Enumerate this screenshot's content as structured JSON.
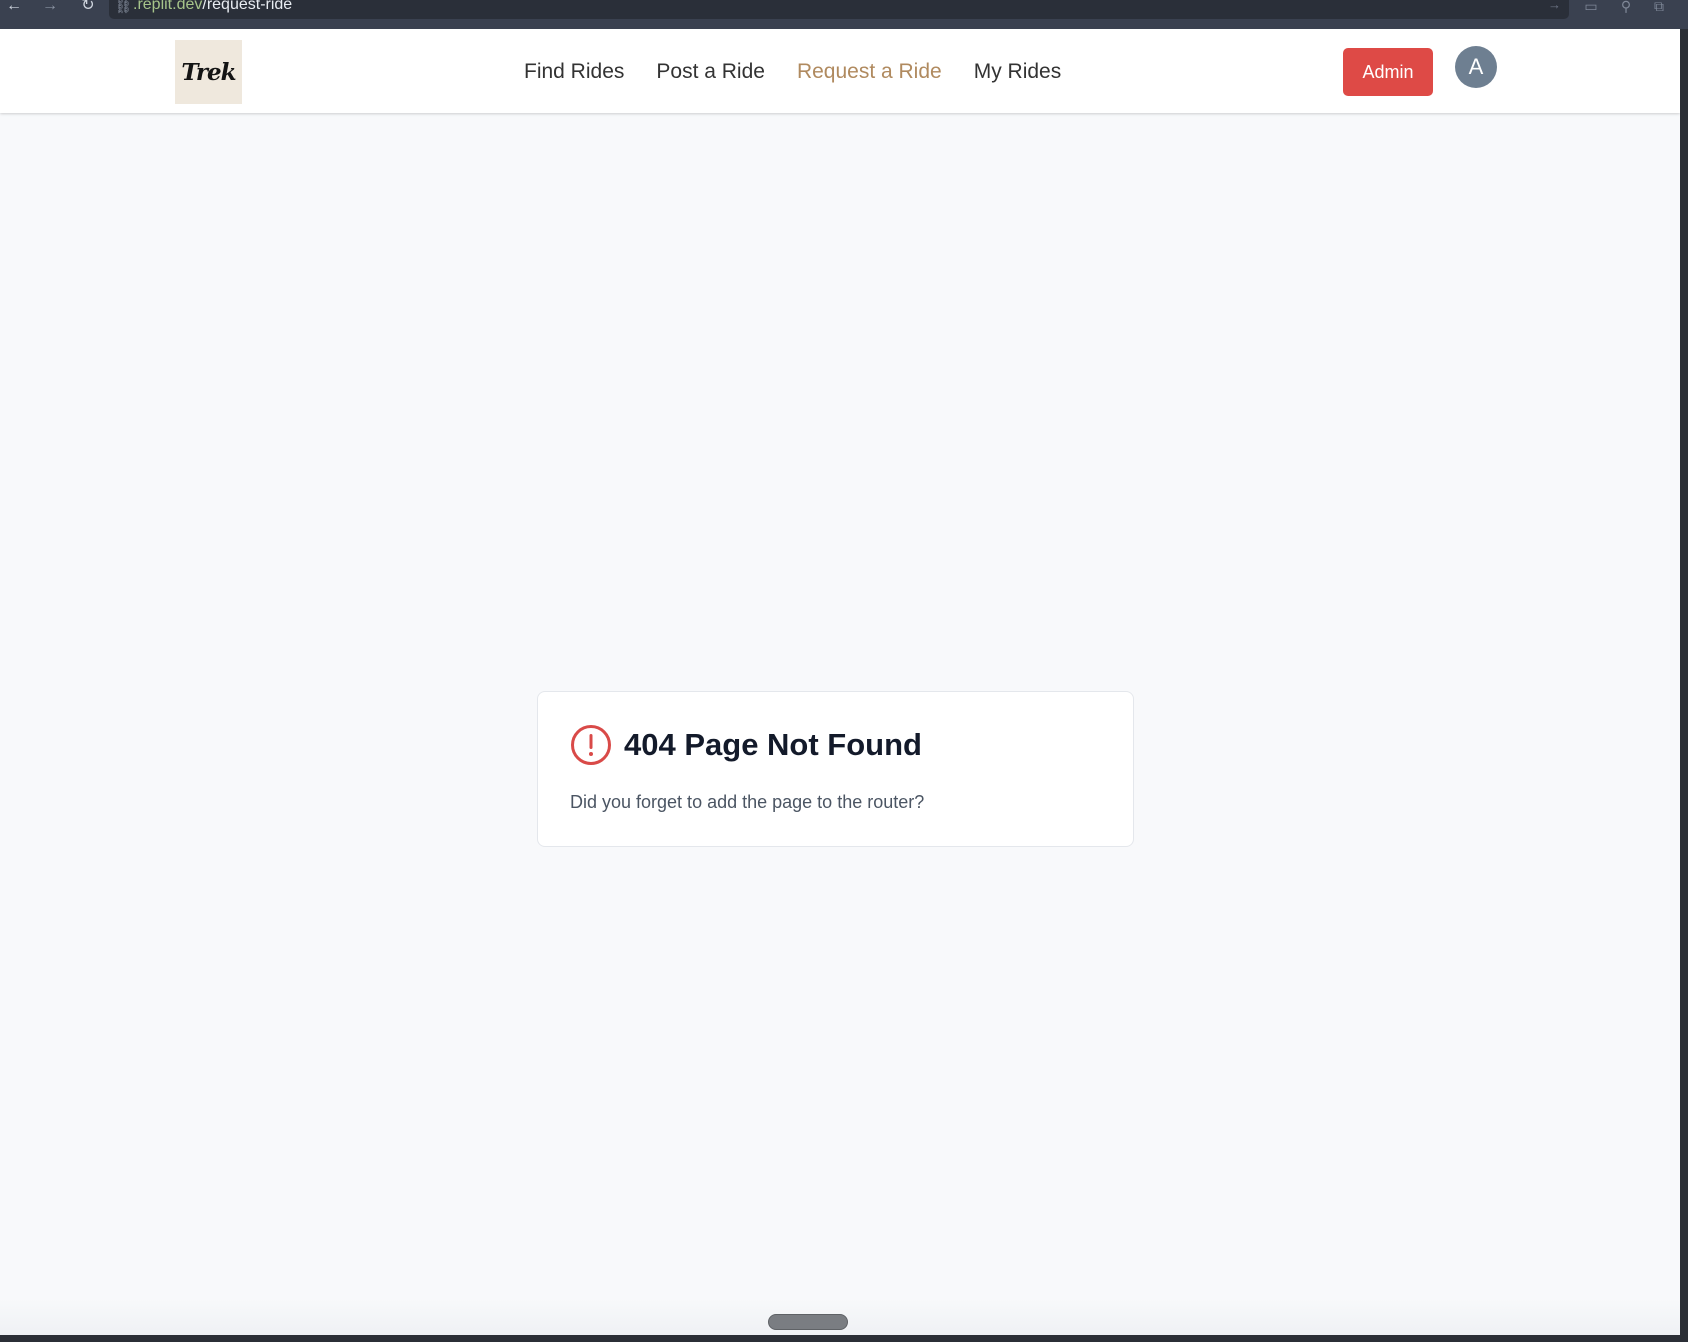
{
  "browser": {
    "url_domain": ".replit.dev",
    "url_path": "/request-ride"
  },
  "header": {
    "logo_text": "Trek",
    "nav": [
      {
        "label": "Find Rides"
      },
      {
        "label": "Post a Ride"
      },
      {
        "label": "Request a Ride",
        "active": true
      },
      {
        "label": "My Rides"
      }
    ],
    "admin_label": "Admin",
    "avatar_initial": "A"
  },
  "error_card": {
    "title": "404 Page Not Found",
    "message": "Did you forget to add the page to the router?"
  },
  "colors": {
    "accent": "#b08a5f",
    "admin_button": "#de4a46",
    "error_icon": "#d94a48",
    "page_background": "#f8f9fb"
  }
}
